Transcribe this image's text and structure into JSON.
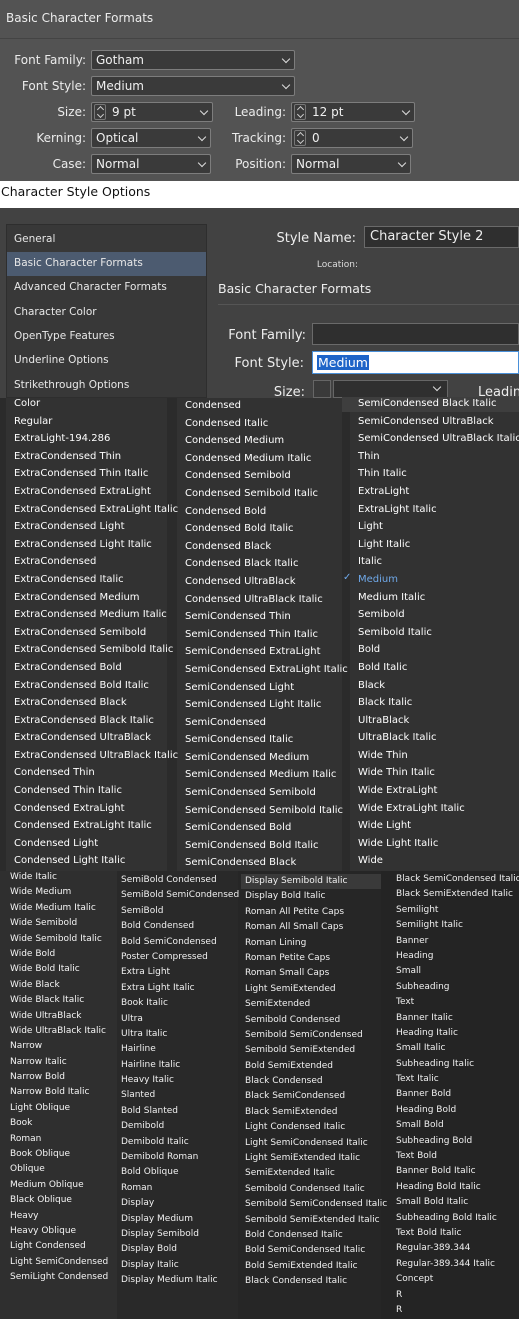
{
  "panel1": {
    "title": "Basic Character Formats",
    "font_family_label": "Font Family:",
    "font_family_value": "Gotham",
    "font_style_label": "Font Style:",
    "font_style_value": "Medium",
    "size_label": "Size:",
    "size_value": "9 pt",
    "leading_label": "Leading:",
    "leading_value": "12 pt",
    "kerning_label": "Kerning:",
    "kerning_value": "Optical",
    "tracking_label": "Tracking:",
    "tracking_value": "0",
    "case_label": "Case:",
    "case_value": "Normal",
    "position_label": "Position:",
    "position_value": "Normal"
  },
  "dialog": {
    "title": "Character Style Options",
    "sidebar": [
      "General",
      "Basic Character Formats",
      "Advanced Character Formats",
      "Character Color",
      "OpenType Features",
      "Underline Options",
      "Strikethrough Options"
    ],
    "style_name_label": "Style Name:",
    "style_name_value": "Character Style 2",
    "location_label": "Location:",
    "section_title": "Basic Character Formats",
    "font_family_label": "Font Family:",
    "font_style_label": "Font Style:",
    "font_style_value": "Medium",
    "size_label": "Size:",
    "leading_label": "Leadin"
  },
  "menu": {
    "col1": [
      "Color",
      "Regular",
      "ExtraLight-194.286",
      "ExtraCondensed Thin",
      "ExtraCondensed Thin Italic",
      "ExtraCondensed ExtraLight",
      "ExtraCondensed ExtraLight Italic",
      "ExtraCondensed Light",
      "ExtraCondensed Light Italic",
      "ExtraCondensed",
      "ExtraCondensed Italic",
      "ExtraCondensed Medium",
      "ExtraCondensed Medium Italic",
      "ExtraCondensed Semibold",
      "ExtraCondensed Semibold Italic",
      "ExtraCondensed Bold",
      "ExtraCondensed Bold Italic",
      "ExtraCondensed Black",
      "ExtraCondensed Black Italic",
      "ExtraCondensed UltraBlack",
      "ExtraCondensed UltraBlack Italic",
      "Condensed Thin",
      "Condensed Thin Italic",
      "Condensed ExtraLight",
      "Condensed ExtraLight Italic",
      "Condensed Light",
      "Condensed Light Italic"
    ],
    "col2": [
      "Condensed",
      "Condensed Italic",
      "Condensed Medium",
      "Condensed Medium Italic",
      "Condensed Semibold",
      "Condensed Semibold Italic",
      "Condensed Bold",
      "Condensed Bold Italic",
      "Condensed Black",
      "Condensed Black Italic",
      "Condensed UltraBlack",
      "Condensed UltraBlack Italic",
      "SemiCondensed Thin",
      "SemiCondensed Thin Italic",
      "SemiCondensed ExtraLight",
      "SemiCondensed ExtraLight Italic",
      "SemiCondensed Light",
      "SemiCondensed Light Italic",
      "SemiCondensed",
      "SemiCondensed Italic",
      "SemiCondensed Medium",
      "SemiCondensed Medium Italic",
      "SemiCondensed Semibold",
      "SemiCondensed Semibold Italic",
      "SemiCondensed Bold",
      "SemiCondensed Bold Italic",
      "SemiCondensed Black"
    ],
    "col3": [
      "SemiCondensed Black Italic",
      "SemiCondensed UltraBlack",
      "SemiCondensed UltraBlack Italic",
      "Thin",
      "Thin Italic",
      "ExtraLight",
      "ExtraLight Italic",
      "Light",
      "Light Italic",
      "Italic",
      "Medium",
      "Medium Italic",
      "Semibold",
      "Semibold Italic",
      "Bold",
      "Bold Italic",
      "Black",
      "Black Italic",
      "UltraBlack",
      "UltraBlack Italic",
      "Wide Thin",
      "Wide Thin Italic",
      "Wide ExtraLight",
      "Wide ExtraLight Italic",
      "Wide Light",
      "Wide Light Italic",
      "Wide"
    ],
    "selected_check": "✓",
    "col4": [
      "Wide Italic",
      "Wide Medium",
      "Wide Medium Italic",
      "Wide Semibold",
      "Wide Semibold Italic",
      "Wide Bold",
      "Wide Bold Italic",
      "Wide Black",
      "Wide Black Italic",
      "Wide UltraBlack",
      "Wide UltraBlack Italic",
      "Narrow",
      "Narrow Italic",
      "Narrow Bold",
      "Narrow Bold Italic",
      "Light Oblique",
      "Book",
      "Roman",
      "Book Oblique",
      "Oblique",
      "Medium Oblique",
      "Black Oblique",
      "Heavy",
      "Heavy Oblique",
      "Light Condensed",
      "Light SemiCondensed",
      "SemiLight Condensed"
    ],
    "col5": [
      "SemiBold Condensed",
      "SemiBold SemiCondensed",
      "SemiBold",
      "Bold Condensed",
      "Bold SemiCondensed",
      "Poster Compressed",
      "Extra Light",
      "Extra Light Italic",
      "Book Italic",
      "Ultra",
      "Ultra Italic",
      "Hairline",
      "Hairline Italic",
      "Heavy Italic",
      "Slanted",
      "Bold Slanted",
      "Demibold",
      "Demibold Italic",
      "Demibold Roman",
      "Bold Oblique",
      "Roman",
      "Display",
      "Display Medium",
      "Display Semibold",
      "Display Bold",
      "Display Italic",
      "Display Medium Italic"
    ],
    "col6": [
      "Display Semibold Italic",
      "Display Bold Italic",
      "Roman All Petite Caps",
      "Roman All Small Caps",
      "Roman Lining",
      "Roman Petite Caps",
      "Roman Small Caps",
      "Light SemiExtended",
      "SemiExtended",
      "Semibold Condensed",
      "Semibold SemiCondensed",
      "Semibold SemiExtended",
      "Bold SemiExtended",
      "Black Condensed",
      "Black SemiCondensed",
      "Black SemiExtended",
      "Light Condensed Italic",
      "Light SemiCondensed Italic",
      "Light SemiExtended Italic",
      "SemiExtended Italic",
      "Semibold Condensed Italic",
      "Semibold SemiCondensed Italic",
      "Semibold SemiExtended Italic",
      "Bold Condensed Italic",
      "Bold SemiCondensed Italic",
      "Bold SemiExtended Italic",
      "Black Condensed Italic"
    ],
    "col7": [
      "Black SemiCondensed Italic",
      "Black SemiExtended Italic",
      "Semilight",
      "Semilight Italic",
      "Banner",
      "Heading",
      "Small",
      "Subheading",
      "Text",
      "Banner Italic",
      "Heading Italic",
      "Small Italic",
      "Subheading Italic",
      "Text Italic",
      "Banner Bold",
      "Heading Bold",
      "Small Bold",
      "Subheading Bold",
      "Text Bold",
      "Banner Bold Italic",
      "Heading Bold Italic",
      "Small Bold Italic",
      "Subheading Bold Italic",
      "Text Bold Italic",
      "Regular-389.344",
      "Regular-389.344 Italic",
      "Concept",
      "R",
      "R"
    ]
  }
}
